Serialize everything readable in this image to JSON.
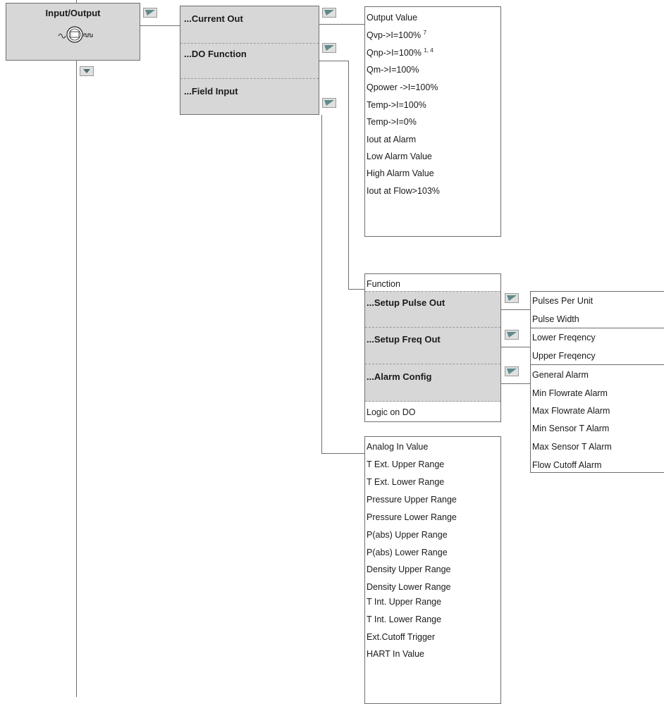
{
  "root": {
    "title": "Input/Output"
  },
  "menu": {
    "current_out": "...Current Out",
    "do_function": "...DO Function",
    "field_input": "...Field Input"
  },
  "current_out_list": [
    "Output Value",
    "Qvp->I=100%",
    "Qnp->I=100%",
    "Qm->I=100%",
    "Qpower ->I=100%",
    "Temp->I=100%",
    "Temp->I=0%",
    "Iout at Alarm",
    "Low Alarm Value",
    "High Alarm Value",
    "Iout at Flow>103%"
  ],
  "footnotes": {
    "qvp": "7",
    "qnp": "1, 4"
  },
  "do_function": {
    "function": "Function",
    "setup_pulse_out": "...Setup Pulse Out",
    "setup_freq_out": "...Setup Freq Out",
    "alarm_config": "...Alarm Config",
    "logic_on_do": "Logic on DO"
  },
  "pulse_out": [
    "Pulses Per Unit",
    "Pulse Width"
  ],
  "freq_out": [
    "Lower Freqency",
    "Upper Freqency"
  ],
  "alarm_config_list": [
    "General Alarm",
    "Min Flowrate Alarm",
    "Max Flowrate Alarm",
    "Min Sensor T Alarm",
    "Max Sensor T Alarm",
    "Flow Cutoff Alarm"
  ],
  "field_input_list": [
    "Analog In Value",
    "T Ext. Upper Range",
    "T Ext. Lower Range",
    "Pressure Upper Range",
    "Pressure Lower Range",
    "P(abs) Upper Range",
    "P(abs) Lower Range",
    "Density Upper Range",
    "Density Lower Range",
    "T Int. Upper Range",
    "T Int. Lower Range",
    "Ext.Cutoff Trigger",
    "HART In Value"
  ],
  "colors": {
    "box_gray": "#d7d7d7",
    "line": "#6e6e6e",
    "icon_fill": "#5f8a8a"
  },
  "icons": {
    "expand": "chevron-down-icon",
    "next": "menu-arrow-icon",
    "device": "flowmeter-icon"
  }
}
